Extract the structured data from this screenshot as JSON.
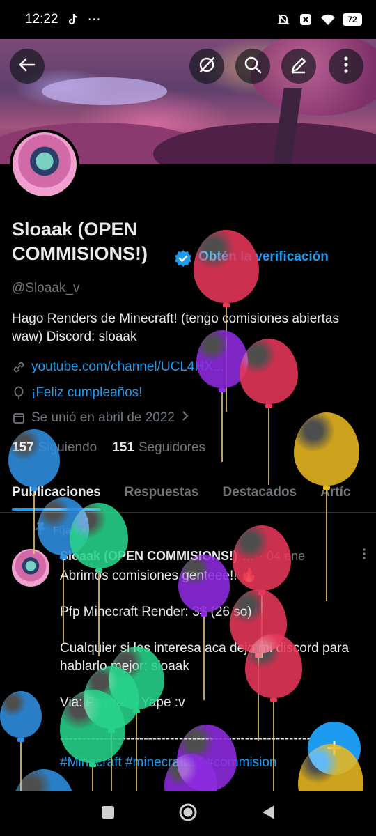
{
  "status_bar": {
    "time": "12:22",
    "dots": "···",
    "battery": "72"
  },
  "header": {
    "back_icon": "arrow-left-icon",
    "grok_icon": "grok-icon",
    "search_icon": "search-icon",
    "compose_icon": "pencil-icon",
    "more_icon": "more-vertical-icon"
  },
  "profile": {
    "name": "Sloaak (OPEN COMMISIONS!)",
    "get_verified": "Obtén la verificación",
    "handle": "@Sloaak_v",
    "bio": "Hago Renders de Minecraft! (tengo comisiones abiertas waw) Discord: sloaak",
    "link": "youtube.com/channel/UCL4HX...",
    "birthday": "¡Feliz cumpleaños!",
    "joined": "Se unió en abril de 2022",
    "following_count": "157",
    "following_label": "Siguiendo",
    "followers_count": "151",
    "followers_label": "Seguidores"
  },
  "tabs": [
    {
      "label": "Publicaciones",
      "active": true
    },
    {
      "label": "Respuestas",
      "active": false
    },
    {
      "label": "Destacados",
      "active": false
    },
    {
      "label": "Artíc",
      "active": false
    }
  ],
  "pinned_label": "Fijado",
  "post": {
    "name": "Sloaak (OPEN COMMISIONS!)",
    "ellipsis": "...",
    "date": "· 04 ene",
    "line1": "Abrimos comisiones genteee!! 🔥",
    "line2": "Pfp Minecraft Render: 3$ (26 so)",
    "line3": "Cualquier si les interesa aca dejo mi discord para hablarlo mejor: sloaak",
    "line4": "Via: Paypal o Yape :v",
    "dashes": "----------------------------------------------------------------",
    "tags": "#Minecraft #minecraftart #commision"
  },
  "fab_label": "+",
  "colors": {
    "accent": "#1d9bf0",
    "background": "#000000",
    "muted": "#71767b",
    "balloon_red": "#e8375a",
    "balloon_purple": "#8e2be0",
    "balloon_yellow": "#e8b820",
    "balloon_blue": "#2f8fe0",
    "balloon_green": "#27d38a"
  }
}
